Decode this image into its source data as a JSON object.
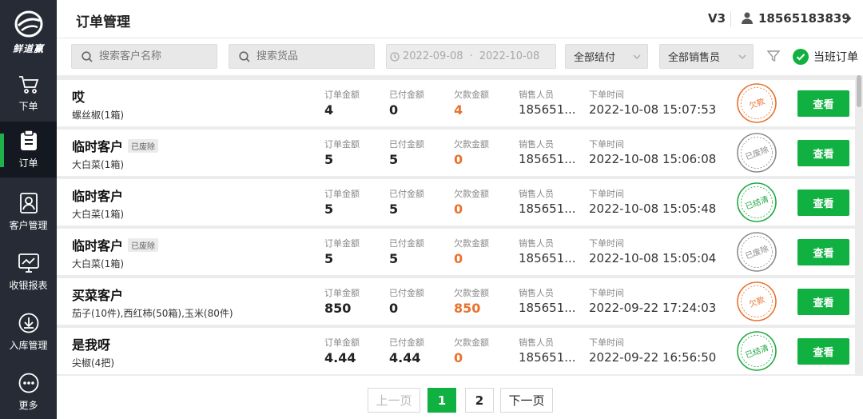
{
  "sidebar": {
    "logo_text": "鲜道赢",
    "items": [
      {
        "label": "下单",
        "icon": "cart-icon"
      },
      {
        "label": "订单",
        "icon": "clipboard-icon",
        "active": true
      },
      {
        "label": "客户管理",
        "icon": "contact-card-icon"
      },
      {
        "label": "收银报表",
        "icon": "chart-monitor-icon"
      },
      {
        "label": "入库管理",
        "icon": "download-circle-icon"
      },
      {
        "label": "更多",
        "icon": "more-dots-icon"
      }
    ]
  },
  "header": {
    "title": "订单管理",
    "version": "V3",
    "user_phone": "18565183839"
  },
  "filters": {
    "customer_search_placeholder": "搜索客户名称",
    "goods_search_placeholder": "搜索货品",
    "date_start": "2022-09-08",
    "date_end": "2022-10-08",
    "settlement_select": "全部结付",
    "salesperson_select": "全部销售员",
    "shift_orders_label": "当班订单"
  },
  "labels": {
    "order_amount": "订单金额",
    "paid_amount": "已付金额",
    "owed_amount": "欠款金额",
    "salesperson": "销售人员",
    "order_time": "下单时间",
    "view_button": "查看"
  },
  "orders": [
    {
      "customer": "哎",
      "badge": "",
      "goods": "螺丝椒(1箱)",
      "order_amount": "4",
      "paid_amount": "0",
      "owed_amount": "4",
      "salesperson": "185651...",
      "order_time": "2022-10-08 15:07:53",
      "stamp": "欠款",
      "stamp_color": "#e8732e"
    },
    {
      "customer": "临时客户",
      "badge": "已废除",
      "goods": "大白菜(1箱)",
      "order_amount": "5",
      "paid_amount": "5",
      "owed_amount": "0",
      "salesperson": "185651...",
      "order_time": "2022-10-08 15:06:08",
      "stamp": "已废除",
      "stamp_color": "#8c8c8c"
    },
    {
      "customer": "临时客户",
      "badge": "",
      "goods": "大白菜(1箱)",
      "order_amount": "5",
      "paid_amount": "5",
      "owed_amount": "0",
      "salesperson": "185651...",
      "order_time": "2022-10-08 15:05:48",
      "stamp": "已结清",
      "stamp_color": "#22aa44"
    },
    {
      "customer": "临时客户",
      "badge": "已废除",
      "goods": "大白菜(1箱)",
      "order_amount": "5",
      "paid_amount": "5",
      "owed_amount": "0",
      "salesperson": "185651...",
      "order_time": "2022-10-08 15:05:04",
      "stamp": "已废除",
      "stamp_color": "#8c8c8c"
    },
    {
      "customer": "买菜客户",
      "badge": "",
      "goods": "茄子(10件),西红柿(50箱),玉米(80件)",
      "order_amount": "850",
      "paid_amount": "0",
      "owed_amount": "850",
      "salesperson": "185651...",
      "order_time": "2022-09-22 17:24:03",
      "stamp": "欠款",
      "stamp_color": "#e8732e"
    },
    {
      "customer": "是我呀",
      "badge": "",
      "goods": "尖椒(4把)",
      "order_amount": "4.44",
      "paid_amount": "4.44",
      "owed_amount": "0",
      "salesperson": "185651...",
      "order_time": "2022-09-22 16:56:50",
      "stamp": "已结清",
      "stamp_color": "#22aa44"
    }
  ],
  "pagination": {
    "prev_label": "上一页",
    "next_label": "下一页",
    "pages": [
      "1",
      "2"
    ],
    "current": "1"
  },
  "colors": {
    "accent_green": "#10b041",
    "owed_orange": "#e8732e",
    "sidebar_bg": "#262b36"
  }
}
